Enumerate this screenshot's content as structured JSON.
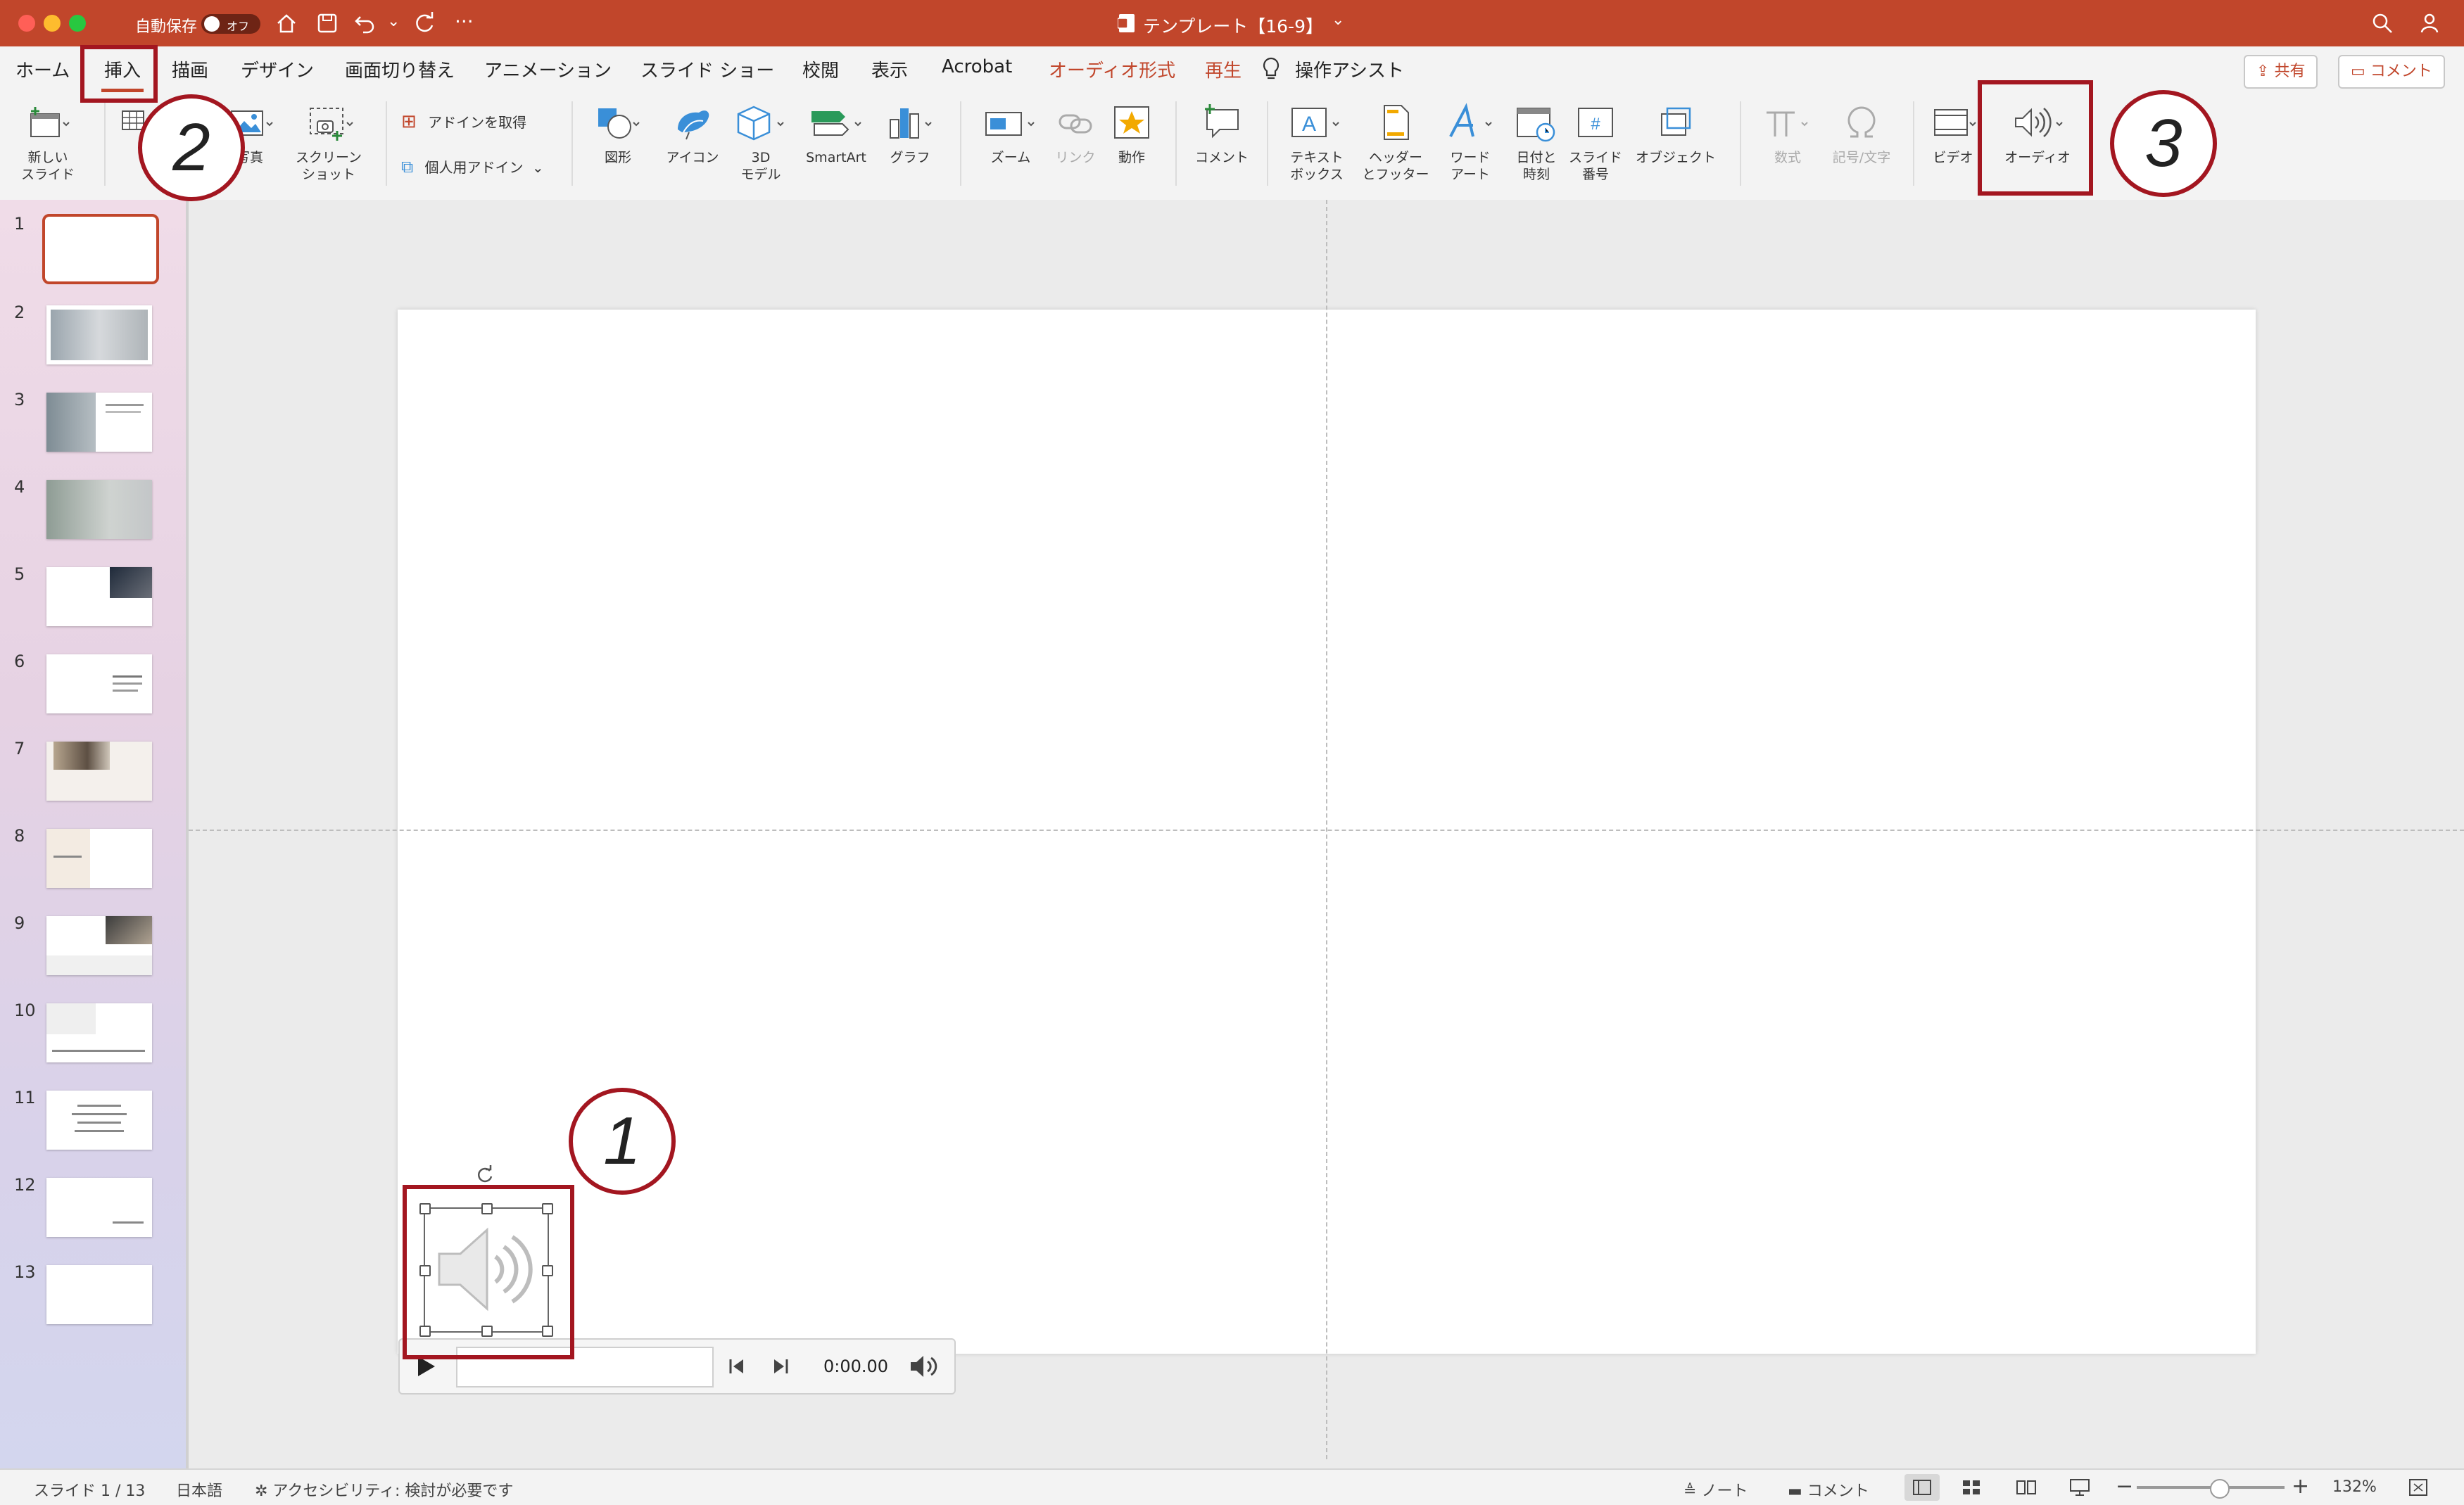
{
  "titlebar": {
    "autosave_label": "自動保存",
    "autosave_state": "オフ",
    "document_title": "テンプレート【16-9】"
  },
  "menu": {
    "items": [
      "ホーム",
      "挿入",
      "描画",
      "デザイン",
      "画面切り替え",
      "アニメーション",
      "スライド ショー",
      "校閲",
      "表示",
      "Acrobat",
      "オーディオ形式",
      "再生"
    ],
    "tell_me": "操作アシスト",
    "share_label": "共有",
    "comment_label": "コメント"
  },
  "ribbon": {
    "new_slide": "新しい\nスライド",
    "photo": "写真",
    "screenshot": "スクリーン\nショット",
    "get_addins": "アドインを取得",
    "my_addins": "個人用アドイン",
    "shapes": "図形",
    "icons": "アイコン",
    "model3d": "3D\nモデル",
    "smartart": "SmartArt",
    "chart": "グラフ",
    "zoom": "ズーム",
    "link": "リンク",
    "action": "動作",
    "comment": "コメント",
    "textbox": "テキスト\nボックス",
    "header_footer": "ヘッダー\nとフッター",
    "wordart": "ワード\nアート",
    "datetime": "日付と\n時刻",
    "slide_number": "スライド\n番号",
    "object": "オブジェクト",
    "equation": "数式",
    "symbol": "記号/文字",
    "video": "ビデオ",
    "audio": "オーディオ"
  },
  "slides": {
    "numbers": [
      "1",
      "2",
      "3",
      "4",
      "5",
      "6",
      "7",
      "8",
      "9",
      "10",
      "11",
      "12",
      "13"
    ]
  },
  "player": {
    "time": "0:00.00"
  },
  "annotations": {
    "step1": "1",
    "step2": "2",
    "step3": "3"
  },
  "statusbar": {
    "slide_info": "スライド 1 / 13",
    "language": "日本語",
    "accessibility": "アクセシビリティ: 検討が必要です",
    "notes": "ノート",
    "comments": "コメント",
    "zoom": "132%"
  },
  "colors": {
    "accent": "#c1462b",
    "annotation": "#a31620"
  }
}
